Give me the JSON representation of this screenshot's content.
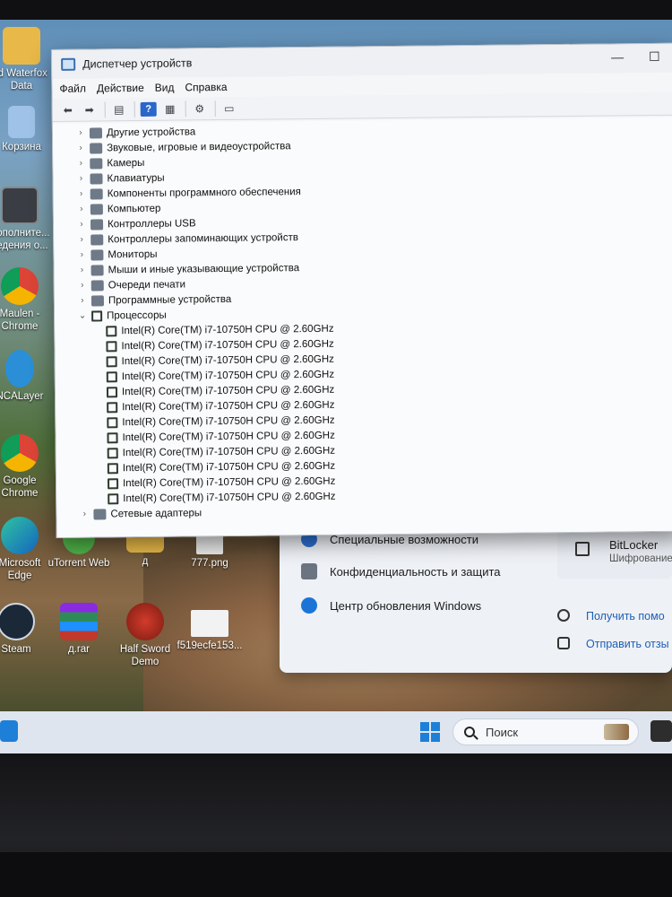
{
  "device_manager": {
    "title": "Диспетчер устройств",
    "window_controls": {
      "minimize": "—",
      "maximize": "☐"
    },
    "menu": [
      "Файл",
      "Действие",
      "Вид",
      "Справка"
    ],
    "categories": [
      {
        "label": "Другие устройства",
        "icon": "device-unknown-icon"
      },
      {
        "label": "Звуковые, игровые и видеоустройства",
        "icon": "speaker-icon"
      },
      {
        "label": "Камеры",
        "icon": "camera-icon"
      },
      {
        "label": "Клавиатуры",
        "icon": "keyboard-icon"
      },
      {
        "label": "Компоненты программного обеспечения",
        "icon": "software-component-icon"
      },
      {
        "label": "Компьютер",
        "icon": "computer-icon"
      },
      {
        "label": "Контроллеры USB",
        "icon": "usb-icon"
      },
      {
        "label": "Контроллеры запоминающих устройств",
        "icon": "storage-controller-icon"
      },
      {
        "label": "Мониторы",
        "icon": "monitor-icon"
      },
      {
        "label": "Мыши и иные указывающие устройства",
        "icon": "mouse-icon"
      },
      {
        "label": "Очереди печати",
        "icon": "printer-icon"
      },
      {
        "label": "Программные устройства",
        "icon": "software-device-icon"
      }
    ],
    "processors": {
      "label": "Процессоры",
      "items": [
        "Intel(R) Core(TM) i7-10750H CPU @ 2.60GHz",
        "Intel(R) Core(TM) i7-10750H CPU @ 2.60GHz",
        "Intel(R) Core(TM) i7-10750H CPU @ 2.60GHz",
        "Intel(R) Core(TM) i7-10750H CPU @ 2.60GHz",
        "Intel(R) Core(TM) i7-10750H CPU @ 2.60GHz",
        "Intel(R) Core(TM) i7-10750H CPU @ 2.60GHz",
        "Intel(R) Core(TM) i7-10750H CPU @ 2.60GHz",
        "Intel(R) Core(TM) i7-10750H CPU @ 2.60GHz",
        "Intel(R) Core(TM) i7-10750H CPU @ 2.60GHz",
        "Intel(R) Core(TM) i7-10750H CPU @ 2.60GHz",
        "Intel(R) Core(TM) i7-10750H CPU @ 2.60GHz",
        "Intel(R) Core(TM) i7-10750H CPU @ 2.60GHz"
      ]
    },
    "partial_last": "Сетевые адаптеры"
  },
  "desktop_icons": {
    "waterfox": "ld Waterfox\nData",
    "recycle": "Корзина",
    "extra": "Дополните...\nведения о...",
    "chrome_user": "Maulen -\nChrome",
    "ncalayer": "NCALayer",
    "chrome": "Google\nChrome",
    "edge": "Microsoft\nEdge",
    "utorrent": "uTorrent Web",
    "folder_d": "д",
    "png": "777.png",
    "steam": "Steam",
    "rar": "д.rar",
    "halfsword": "Half Sword\nDemo",
    "f519": "f519ecfe153..."
  },
  "settings": {
    "accessibility": "Специальные возможности",
    "privacy": "Конфиденциальность и защита",
    "update": "Центр обновления Windows",
    "bitlocker_title": "BitLocker",
    "bitlocker_sub": "Шифрование",
    "get_help": "Получить помо",
    "send_feedback": "Отправить отзы"
  },
  "taskbar": {
    "search_placeholder": "Поиск"
  },
  "colors": {
    "window_bg": "#f5f6f8",
    "taskbar_bg": "#dfe5ee",
    "link": "#1d5fb6",
    "start_blue": "#1e7fd8"
  }
}
